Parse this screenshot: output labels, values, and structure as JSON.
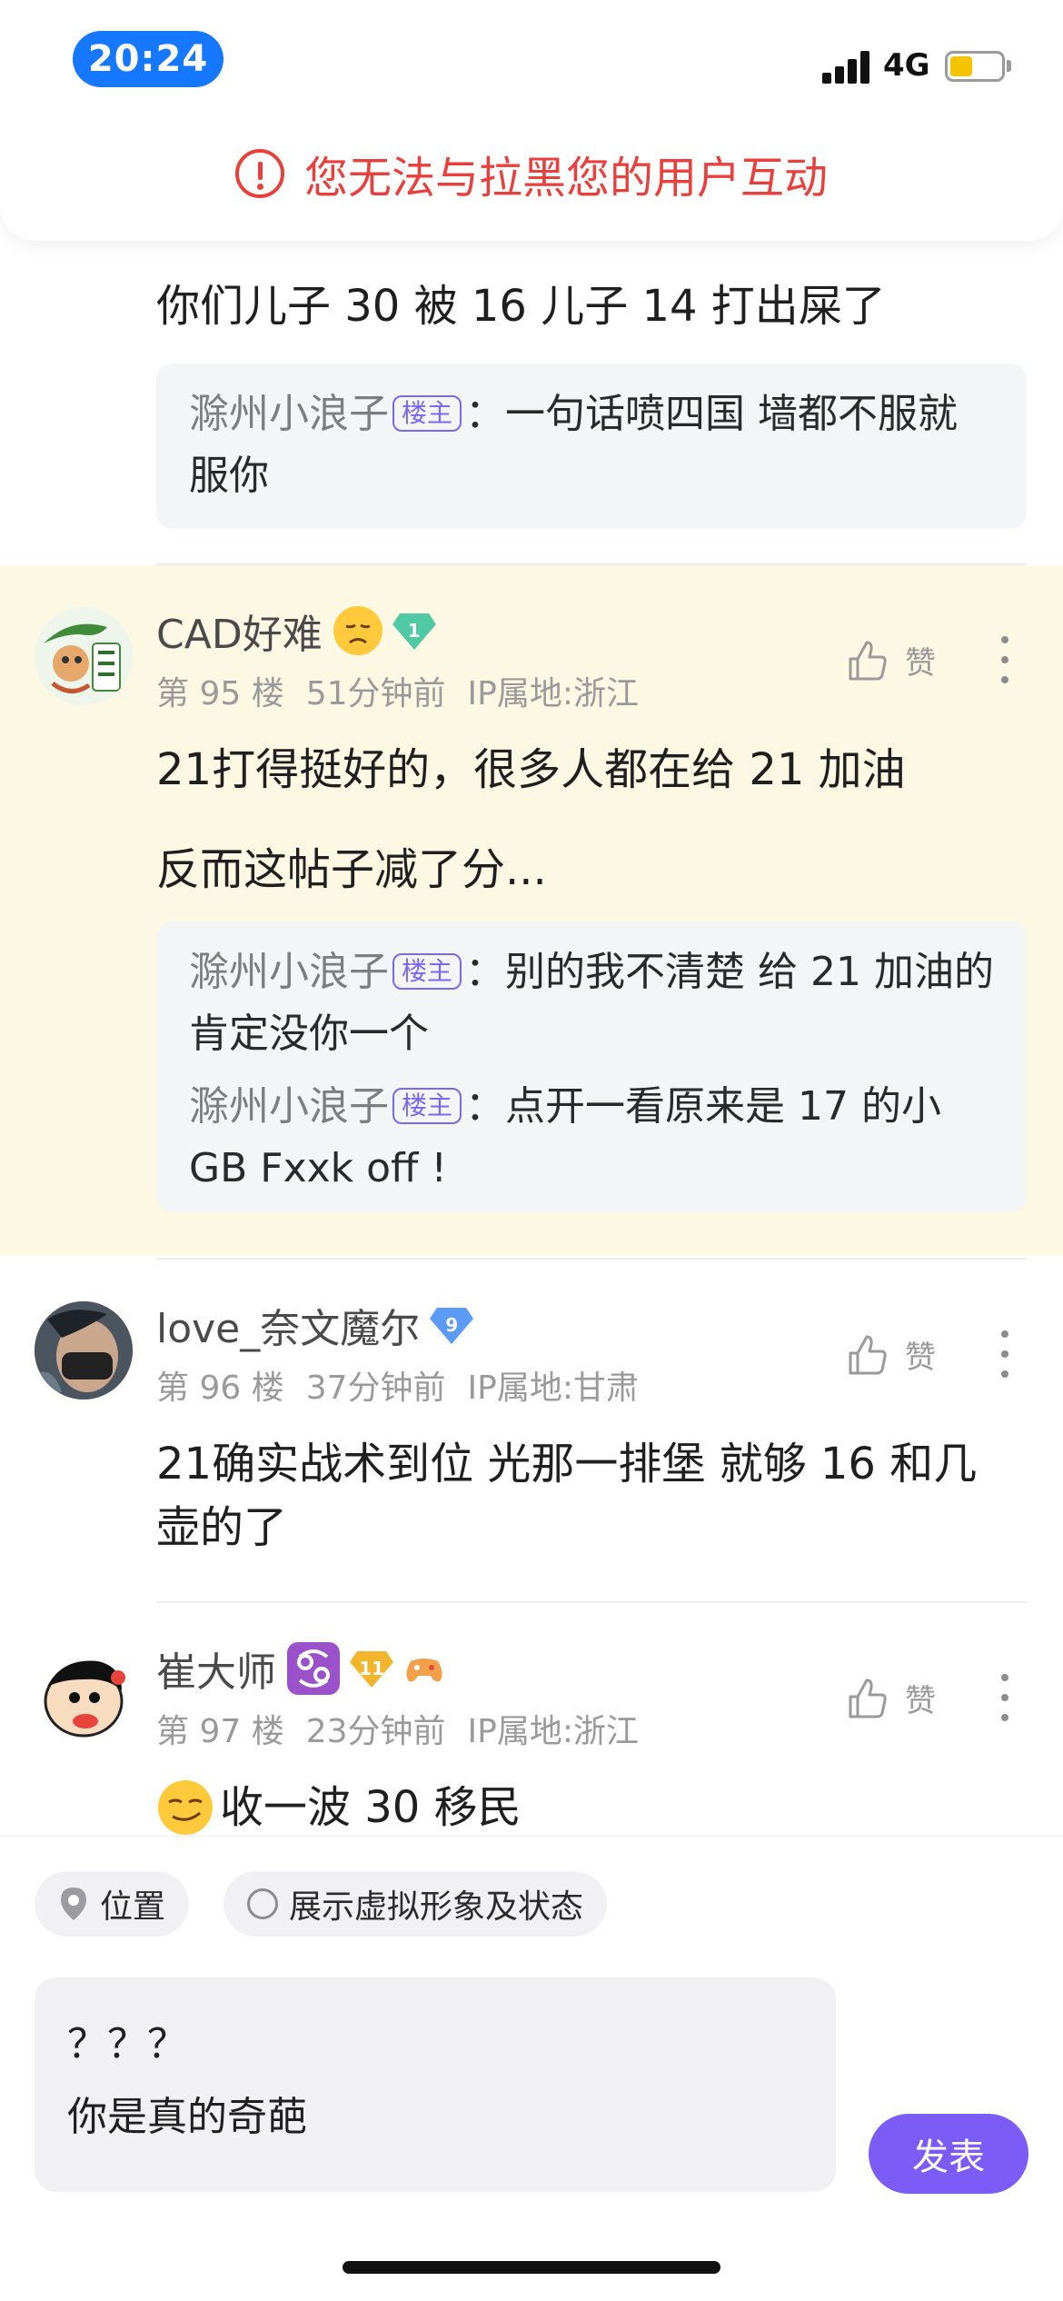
{
  "status_bar": {
    "time": "20:24",
    "network": "4G",
    "battery_level": 0.45,
    "battery_color": "#f5c400",
    "time_pill_color": "#1677ff"
  },
  "alert": {
    "text": "您无法与拉黑您的用户互动",
    "color": "#e8403c"
  },
  "cut_comment": {
    "text": "你们儿子 30 被 16 儿子 14 打出屎了",
    "replies": [
      {
        "name": "滁州小浪子",
        "badge": "楼主",
        "text": "：一句话喷四国 墙都不服就服你"
      }
    ]
  },
  "comments": [
    {
      "username": "CAD好难",
      "level": "1",
      "floor": "第 95 楼",
      "time": "51分钟前",
      "ip": "IP属地:浙江",
      "like_label": "赞",
      "paragraphs": [
        "21打得挺好的，很多人都在给 21 加油",
        "反而这帖子减了分..."
      ],
      "replies": [
        {
          "name": "滁州小浪子",
          "badge": "楼主",
          "text": "：别的我不清楚 给 21 加油的肯定没你一个"
        },
        {
          "name": "滁州小浪子",
          "badge": "楼主",
          "text": "：点开一看原来是 17 的小GB Fxxk off !"
        }
      ]
    },
    {
      "username": "love_奈文魔尔",
      "level": "9",
      "floor": "第 96 楼",
      "time": "37分钟前",
      "ip": "IP属地:甘肃",
      "like_label": "赞",
      "paragraphs": [
        "21确实战术到位 光那一排堡 就够 16 和几壶的了"
      ]
    },
    {
      "username": "崔大师",
      "level": "11",
      "floor": "第 97 楼",
      "time": "23分钟前",
      "ip": "IP属地:浙江",
      "like_label": "赞",
      "paragraphs": [
        "收一波 30 移民"
      ]
    }
  ],
  "composer": {
    "location_chip": "位置",
    "avatar_chip": "展示虚拟形象及状态",
    "input_value": "？？？\n你是真的奇葩",
    "publish_label": "发表",
    "publish_color": "#7b5cf7"
  }
}
